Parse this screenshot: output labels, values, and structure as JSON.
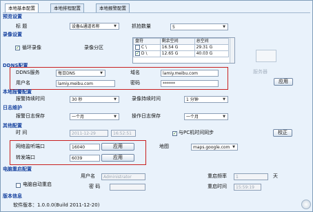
{
  "tabs": [
    {
      "label": "本地基本配置"
    },
    {
      "label": "本地排程配置"
    },
    {
      "label": "本地报警配置"
    }
  ],
  "preview": {
    "section": "预览设置",
    "mode_label": "标  题",
    "mode_value": "设备&通道名称",
    "count_label": "抓拍数量",
    "count_value": "5"
  },
  "record": {
    "section": "录像设置",
    "loop_label": "循环录像",
    "partition_label": "录像分区",
    "table": {
      "headers": [
        "盘符",
        "剩余空间",
        "总空间"
      ],
      "rows": [
        {
          "drive": "C \\",
          "free": "16.54 G",
          "total": "29.31 G"
        },
        {
          "drive": "D \\",
          "free": "12.65 G",
          "total": "40.03 G"
        }
      ]
    }
  },
  "ddns": {
    "section": "DDNS配置",
    "server_label": "DDNS服务",
    "server_value": "每日DNS",
    "domain_label": "域名",
    "domain_value": "lamiy.meibu.com",
    "user_label": "用户名",
    "user_value": "lamiy.meibu.com",
    "pass_label": "密码",
    "pass_value": "******",
    "server_faded": "服务器",
    "apply_label": "应用"
  },
  "alarm": {
    "section": "本地报警配置",
    "duration_label": "报警持续时间",
    "duration_value": "30 秒",
    "rec_duration_label": "录像持续时间",
    "rec_duration_value": "1 分钟"
  },
  "log": {
    "section": "日志维护",
    "alarm_keep_label": "报警日志保存",
    "alarm_keep_value": "一个月",
    "op_keep_label": "操作日志保存",
    "op_keep_value": "一个月"
  },
  "other": {
    "section": "其他配置",
    "time_label": "时  间",
    "date_value": "2011-12-29",
    "clock_value": "16:52:51",
    "sync_label": "与PC机时间同步",
    "calibrate_label": "校正",
    "listen_port_label": "网络监听端口",
    "listen_port_value": "16040",
    "forward_port_label": "转发端口",
    "forward_port_value": "6039",
    "apply_label": "应用",
    "map_label": "地图",
    "map_value": "maps.google.com"
  },
  "power": {
    "section": "电脑重启配置",
    "user_label": "用户名",
    "user_value": "Administrator",
    "pass_label": "密  码",
    "auto_label": "电脑自动重启",
    "freq_label": "重启频率",
    "freq_value": "1",
    "freq_unit": "天",
    "time_label": "重启时间",
    "time_value": "15:59:19"
  },
  "version": {
    "section": "版本信息",
    "text": "软件版本：1.0.0.0(Build 2011-12-20)"
  },
  "colors": {
    "accent": "#1a45a0",
    "highlight_border": "#c81e1e",
    "background": "#e9f2fb"
  }
}
